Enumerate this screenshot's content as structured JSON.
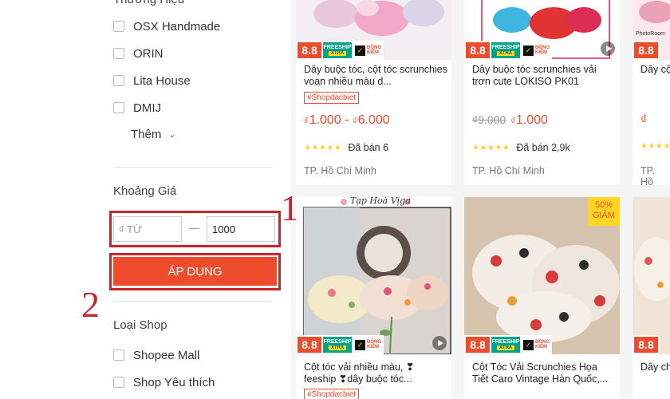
{
  "sidebar": {
    "brand_heading": "Thương Hiệu",
    "brands": [
      "OSX Handmade",
      "ORIN",
      "Lita House",
      "DMIJ"
    ],
    "more_label": "Thêm",
    "price_heading": "Khoảng Giá",
    "price_min_placeholder": "₫ TỪ",
    "price_max_value": "1000",
    "apply_label": "ÁP DỤNG",
    "shop_type_heading": "Loại Shop",
    "shop_types": [
      "Shopee Mall",
      "Shop Yêu thích"
    ]
  },
  "callouts": {
    "first": "1",
    "second": "2"
  },
  "badges": {
    "sale": "8.8",
    "freeship": "FREESHIP",
    "xtra": "XTRA",
    "dong": "ĐỒNG",
    "kiem": "KIỂM"
  },
  "products": [
    {
      "name": "Dây buộc tóc, cột tóc scrunchies voan nhiều màu d...",
      "tag": "#Shopdacbiet",
      "currency": "₫",
      "price_min": "1.000",
      "price_sep": "-",
      "price_max": "6.000",
      "rating_stars": "★★★★★",
      "sold": "Đã bán 6",
      "location": "TP. Hồ Chí Minh"
    },
    {
      "name": "Dây buộc tóc scrunchies vải trơn cute LOKISO PK01",
      "old_price": "₫9.000",
      "currency": "₫",
      "price": "1.000",
      "rating_stars": "★★★★★",
      "sold": "Đã bán 2,9k",
      "location": "TP. Hồ Chí Minh",
      "image_text": "PhotoRoom"
    },
    {
      "name": "Dây cộ",
      "currency": "₫",
      "price_partial": "₫",
      "rating_stars": "★★★★★",
      "location": "TP. Hồ",
      "image_text": "PhotoRoom"
    },
    {
      "name": "Cột tóc vải nhiều màu, ❣ feeship ❣dây buộc tóc...",
      "tag": "#Shopdacbiet",
      "image_text": "Tạp Hoá Vịga"
    },
    {
      "name": "Cột Tóc Vải Scrunchies Họa Tiết Caro Vintage Hàn Quốc,...",
      "discount_percent": "50%",
      "discount_label": "GIẢM"
    },
    {
      "name": "Dây ch nhiều"
    }
  ]
}
